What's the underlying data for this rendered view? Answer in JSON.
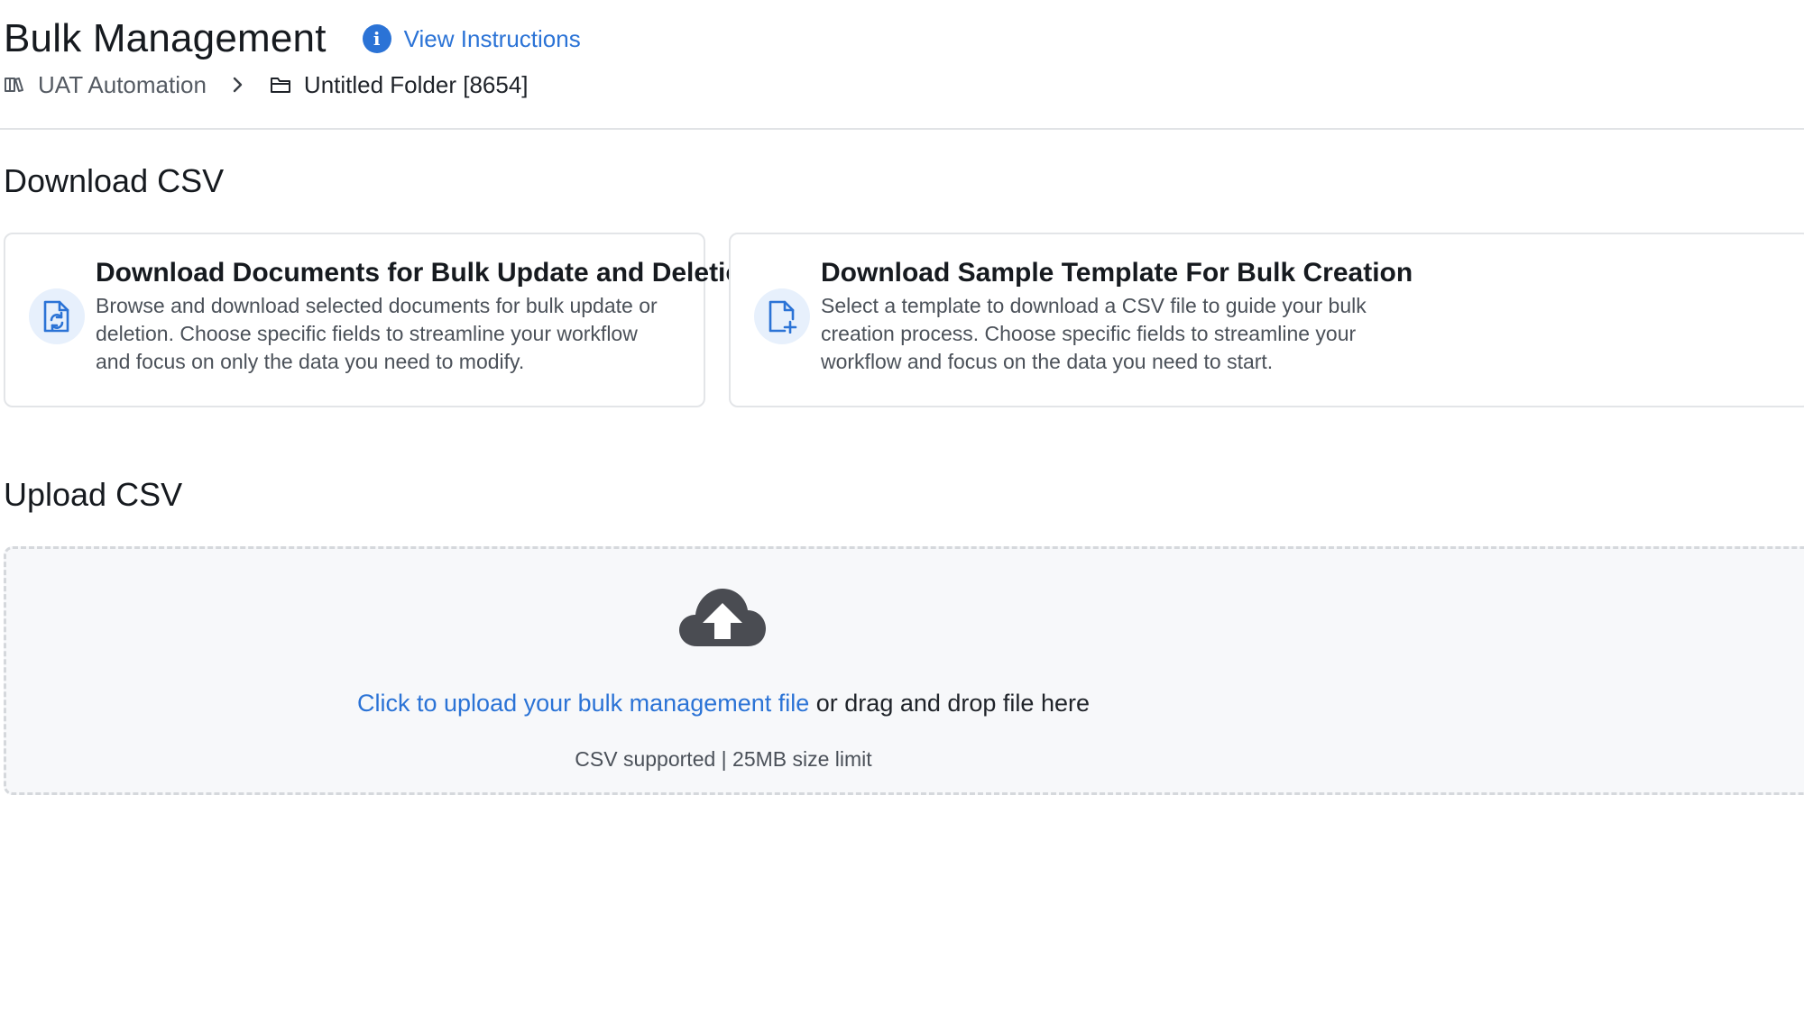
{
  "header": {
    "title": "Bulk Management",
    "instructions_link": "View Instructions"
  },
  "breadcrumb": {
    "items": [
      {
        "label": "UAT Automation",
        "icon": "library-icon"
      },
      {
        "label": "Untitled Folder [8654]",
        "icon": "folder-icon"
      }
    ]
  },
  "download_section": {
    "title": "Download CSV",
    "cards": [
      {
        "title": "Download Documents for Bulk Update and Deletion",
        "description": "Browse and download selected documents for bulk update or deletion. Choose specific fields to streamline your workflow and focus on only the data you need to modify.",
        "icon": "document-refresh-icon"
      },
      {
        "title": "Download Sample Template For Bulk Creation",
        "description": "Select a template to download a CSV file to guide your bulk creation process. Choose specific fields to streamline your workflow and focus on the data you need to start.",
        "icon": "document-add-icon"
      }
    ]
  },
  "upload_section": {
    "title": "Upload CSV",
    "link_text": "Click to upload your bulk management file",
    "drag_text": " or drag and drop file here",
    "hint": "CSV supported | 25MB size limit",
    "icon": "cloud-upload-icon"
  },
  "colors": {
    "accent": "#2b73d6",
    "icon_bg": "#e7f0fc",
    "dropzone_bg": "#f7f8fa",
    "cloud": "#4a4c52"
  }
}
